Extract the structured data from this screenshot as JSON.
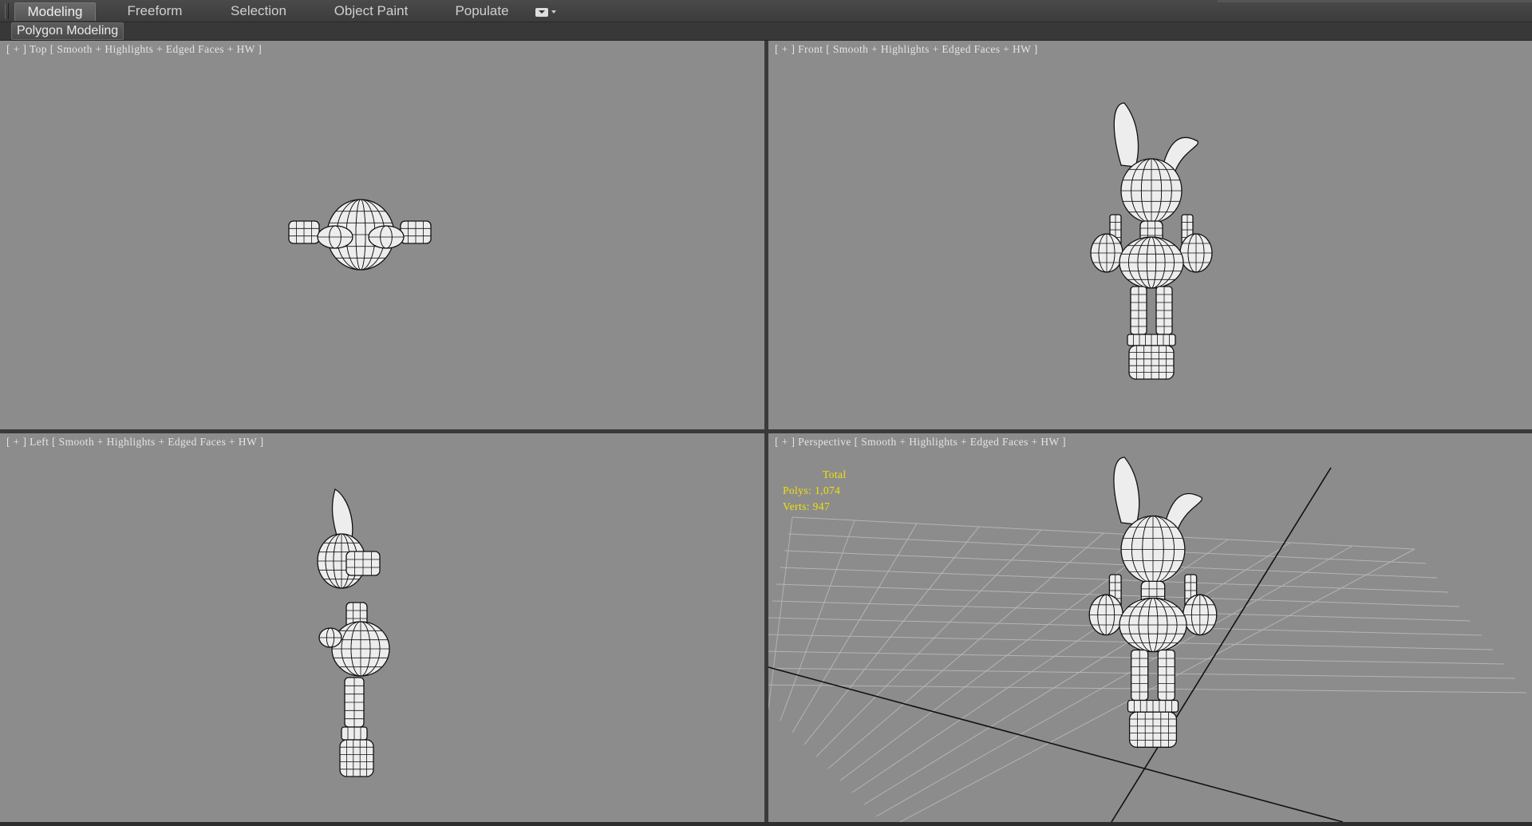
{
  "ribbon": {
    "tabs": [
      {
        "label": "Modeling",
        "active": true
      },
      {
        "label": "Freeform",
        "active": false
      },
      {
        "label": "Selection",
        "active": false
      },
      {
        "label": "Object Paint",
        "active": false
      },
      {
        "label": "Populate",
        "active": false
      }
    ],
    "panel_label": "Polygon Modeling",
    "menu_icon": "display-dropdown-icon"
  },
  "viewports": [
    {
      "id": "top",
      "plus": "[ + ]",
      "name": "Top",
      "shading": "[ Smooth + Highlights + Edged Faces + HW ]"
    },
    {
      "id": "front",
      "plus": "[ + ]",
      "name": "Front",
      "shading": "[ Smooth + Highlights + Edged Faces + HW ]"
    },
    {
      "id": "left",
      "plus": "[ + ]",
      "name": "Left",
      "shading": "[ Smooth + Highlights + Edged Faces + HW ]"
    },
    {
      "id": "perspective",
      "plus": "[ + ]",
      "name": "Perspective",
      "shading": "[ Smooth + Highlights + Edged Faces + HW ]"
    }
  ],
  "stats": {
    "total_label": "Total",
    "polys": "Polys: 1,074",
    "verts": "Verts: 947"
  },
  "colors": {
    "viewport_bg": "#8c8c8c",
    "stats_text": "#f2e00a",
    "ui_bg": "#3a3a3a",
    "mesh_fill": "#ededed",
    "mesh_wire": "#111111"
  }
}
